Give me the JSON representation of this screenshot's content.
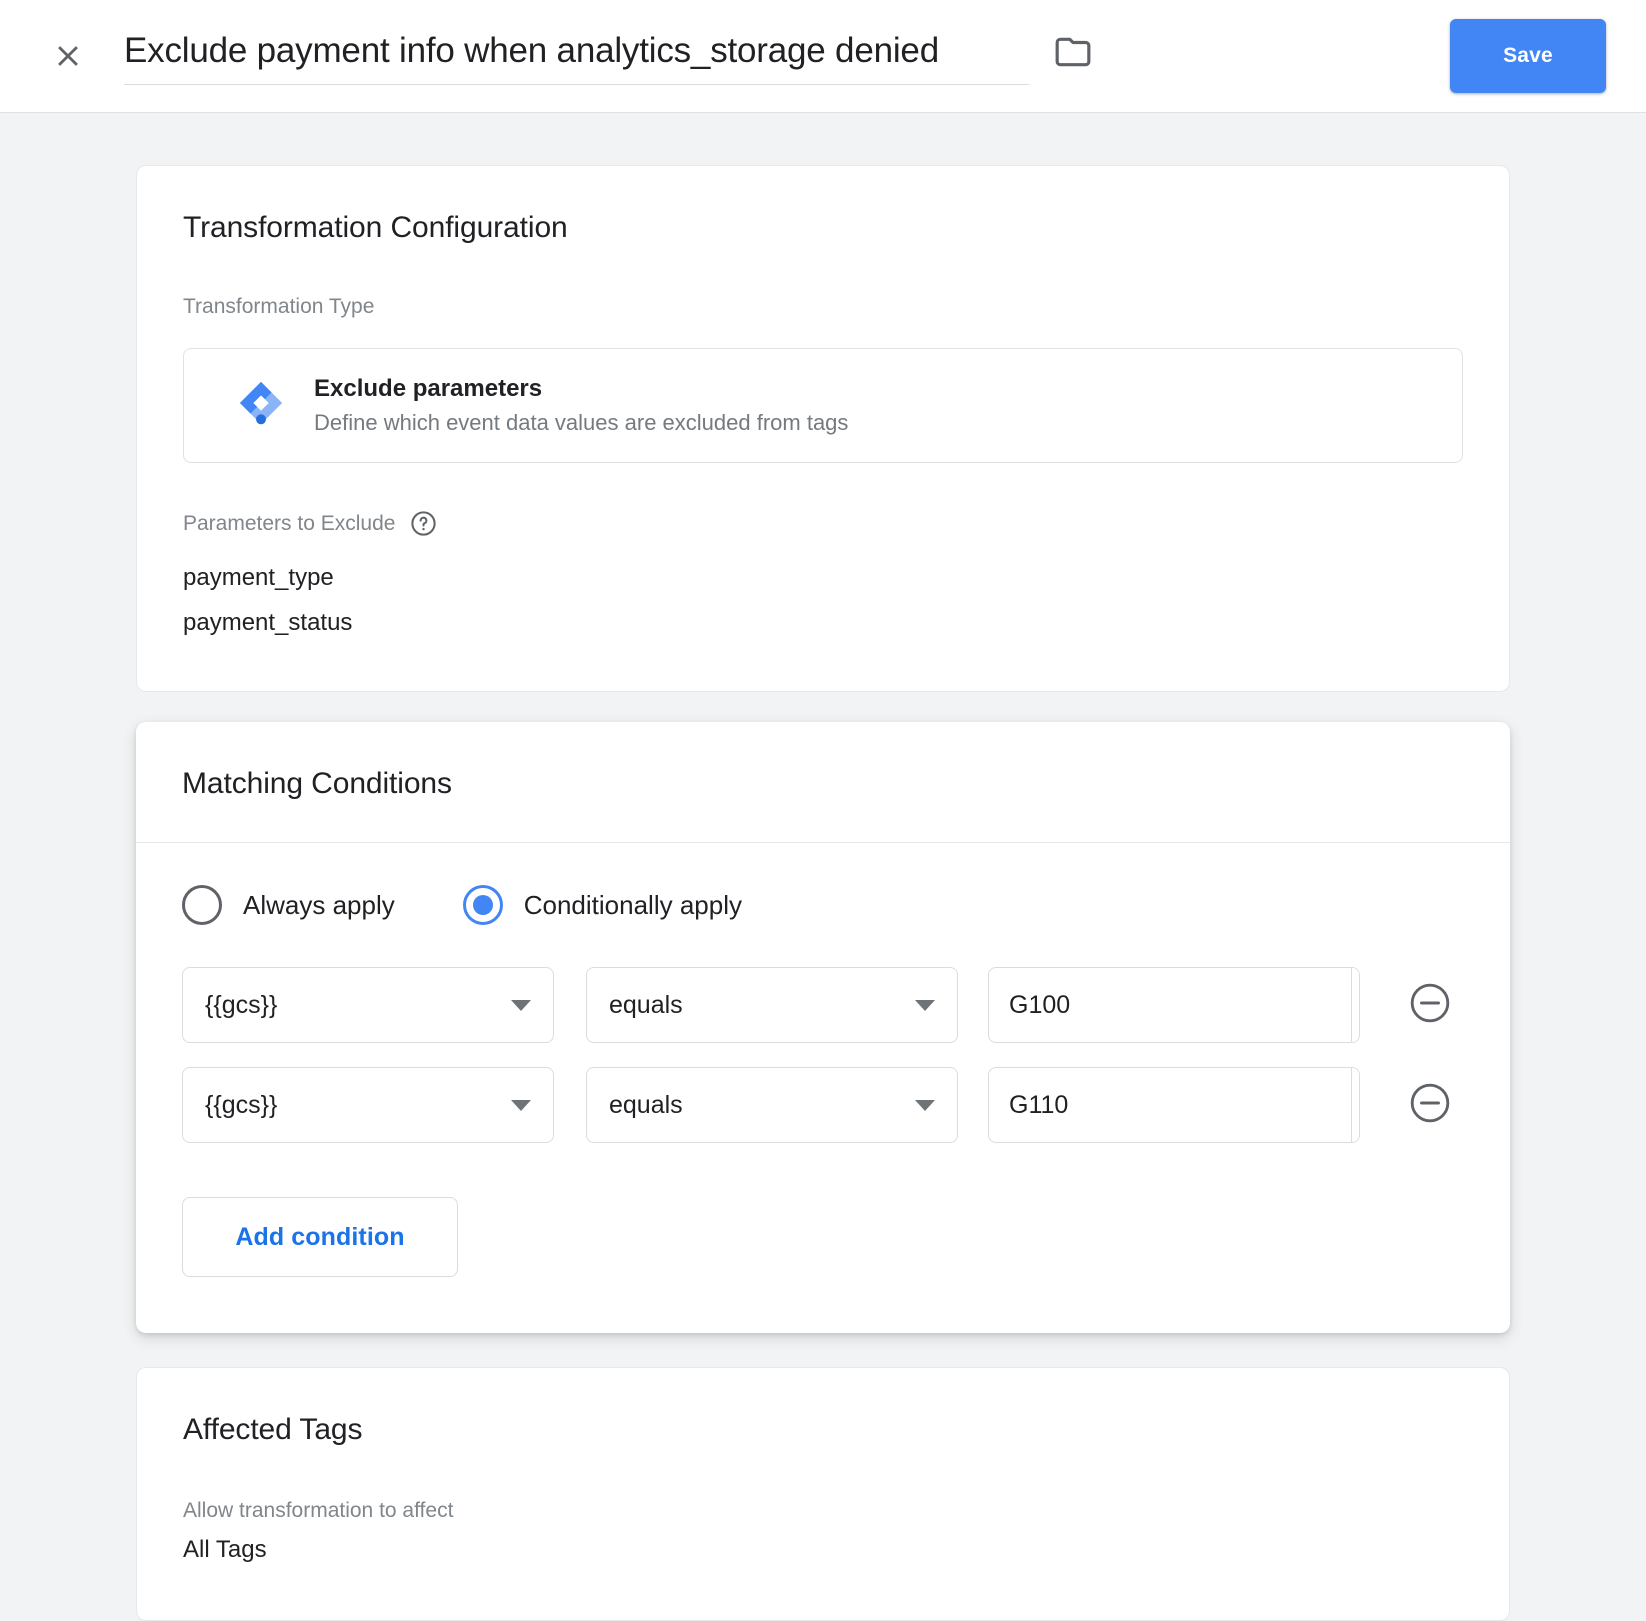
{
  "header": {
    "close_icon": "close-icon",
    "title_value": "Exclude payment info when analytics_storage denied",
    "title_placeholder": "Untitled Transformation",
    "folder_icon": "folder-icon",
    "save_label": "Save",
    "accent_color": "#4285f4"
  },
  "transformation": {
    "card_title": "Transformation Configuration",
    "type_label": "Transformation Type",
    "type_icon": "gtm-diamond-icon",
    "type_name": "Exclude parameters",
    "type_description": "Define which event data values are excluded from tags",
    "params_label": "Parameters to Exclude",
    "help_icon": "help-circle-icon",
    "parameters": [
      "payment_type",
      "payment_status"
    ]
  },
  "matching": {
    "card_title": "Matching Conditions",
    "apply_mode": {
      "options": [
        {
          "label": "Always apply",
          "selected": false
        },
        {
          "label": "Conditionally apply",
          "selected": true
        }
      ]
    },
    "conditions": [
      {
        "variable": "{{gcs}}",
        "operator": "equals",
        "value": "G100",
        "value_placeholder": "",
        "variable_icon": "chevron-down-icon",
        "operator_icon": "chevron-down-icon",
        "brick_icon": "add-variable-brick-icon",
        "remove_icon": "remove-circle-icon"
      },
      {
        "variable": "{{gcs}}",
        "operator": "equals",
        "value": "G110",
        "value_placeholder": "",
        "variable_icon": "chevron-down-icon",
        "operator_icon": "chevron-down-icon",
        "brick_icon": "add-variable-brick-icon",
        "remove_icon": "remove-circle-icon"
      }
    ],
    "add_condition_label": "Add condition"
  },
  "affected": {
    "card_title": "Affected Tags",
    "allow_label": "Allow transformation to affect",
    "allow_value": "All Tags"
  }
}
